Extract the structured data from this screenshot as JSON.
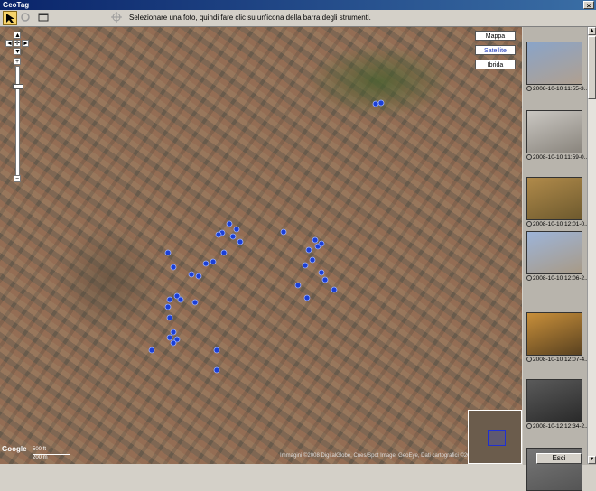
{
  "window": {
    "title": "GeoTag",
    "close_glyph": "×"
  },
  "toolbar": {
    "instruction": "Selezionare una foto, quindi fare clic su un'icona della barra degli strumenti.",
    "buttons": [
      {
        "icon": "select-arrow-icon",
        "active": true
      },
      {
        "icon": "circle-icon",
        "active": false
      },
      {
        "icon": "window-icon",
        "active": false
      },
      {
        "icon": "target-icon",
        "active": false
      }
    ]
  },
  "map": {
    "type_buttons": {
      "map": "Mappa",
      "satellite": "Satellite",
      "hybrid": "Ibrida",
      "selected": "Satellite"
    },
    "zoom": {
      "plus": "+",
      "minus": "−",
      "up": "▲",
      "down": "▼",
      "left": "◄",
      "right": "►",
      "center": "✛"
    },
    "scale": {
      "top": "500 ft",
      "bottom": "200 m"
    },
    "credit": "Immagini ©2008 DigitalGlobe, Cnes/Spot Image, GeoEye, Dati cartografici ©2008 Tele Atlas",
    "logo": "Google",
    "pin_color": "#1b3fd6",
    "pin_count": 40
  },
  "thumbnails": [
    {
      "caption": "2008-10-10 11:55-3...",
      "colors": [
        "#8aa4c8",
        "#b0a090"
      ]
    },
    {
      "caption": "2008-10-10 11:59-0...",
      "colors": [
        "#c9c6c1",
        "#8a857d"
      ]
    },
    {
      "caption": "2008-10-10 12:01-0...",
      "colors": [
        "#b08a4a",
        "#6e5a2e"
      ]
    },
    {
      "caption": "2008-10-10 12:06-2...",
      "colors": [
        "#9db4d8",
        "#a89a86"
      ]
    },
    {
      "caption": "2008-10-10 12:07-4...",
      "colors": [
        "#c88f3a",
        "#5a4220"
      ]
    },
    {
      "caption": "2008-10-12 12:34-2...",
      "colors": [
        "#5a5a5a",
        "#2a2a2a"
      ]
    },
    {
      "caption": "",
      "colors": [
        "#777777",
        "#555555"
      ]
    }
  ],
  "footer": {
    "exit": "Esci"
  }
}
